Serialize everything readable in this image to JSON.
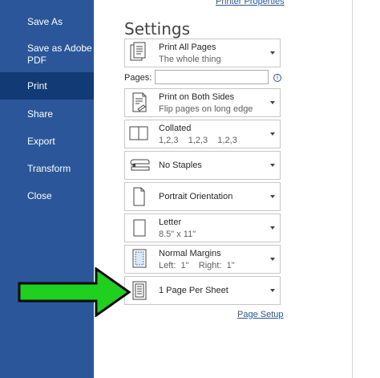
{
  "nav": {
    "items": [
      {
        "label": "Save As",
        "active": false
      },
      {
        "label": "Save as Adobe\nPDF",
        "active": false
      },
      {
        "label": "Print",
        "active": true
      },
      {
        "label": "Share",
        "active": false
      },
      {
        "label": "Export",
        "active": false
      },
      {
        "label": "Transform",
        "active": false
      },
      {
        "label": "Close",
        "active": false
      }
    ]
  },
  "printer_properties_link": "Printer Properties",
  "settings": {
    "title": "Settings",
    "pages_label": "Pages:",
    "pages_value": "",
    "info_glyph": "i",
    "dropdowns": [
      {
        "icon": "print-all-pages-icon",
        "title": "Print All Pages",
        "subtitle": "The whole thing"
      },
      {
        "icon": "duplex-icon",
        "title": "Print on Both Sides",
        "subtitle": "Flip pages on long edge"
      },
      {
        "icon": "collated-icon",
        "title": "Collated",
        "subtitle": "1,2,3    1,2,3    1,2,3"
      },
      {
        "icon": "stapler-icon",
        "title": "No Staples",
        "subtitle": ""
      },
      {
        "icon": "portrait-icon",
        "title": "Portrait Orientation",
        "subtitle": ""
      },
      {
        "icon": "letter-paper-icon",
        "title": "Letter",
        "subtitle": "8.5\" x 11\""
      },
      {
        "icon": "margins-icon",
        "title": "Normal Margins",
        "subtitle": "Left:  1\"    Right:  1\""
      },
      {
        "icon": "pages-per-sheet-icon",
        "title": "1 Page Per Sheet",
        "subtitle": ""
      }
    ],
    "page_setup_link": "Page Setup"
  },
  "colors": {
    "nav_background": "#2b579a",
    "nav_active": "#123a74",
    "link": "#2b579a",
    "annotation_arrow": "#1fd01f"
  }
}
